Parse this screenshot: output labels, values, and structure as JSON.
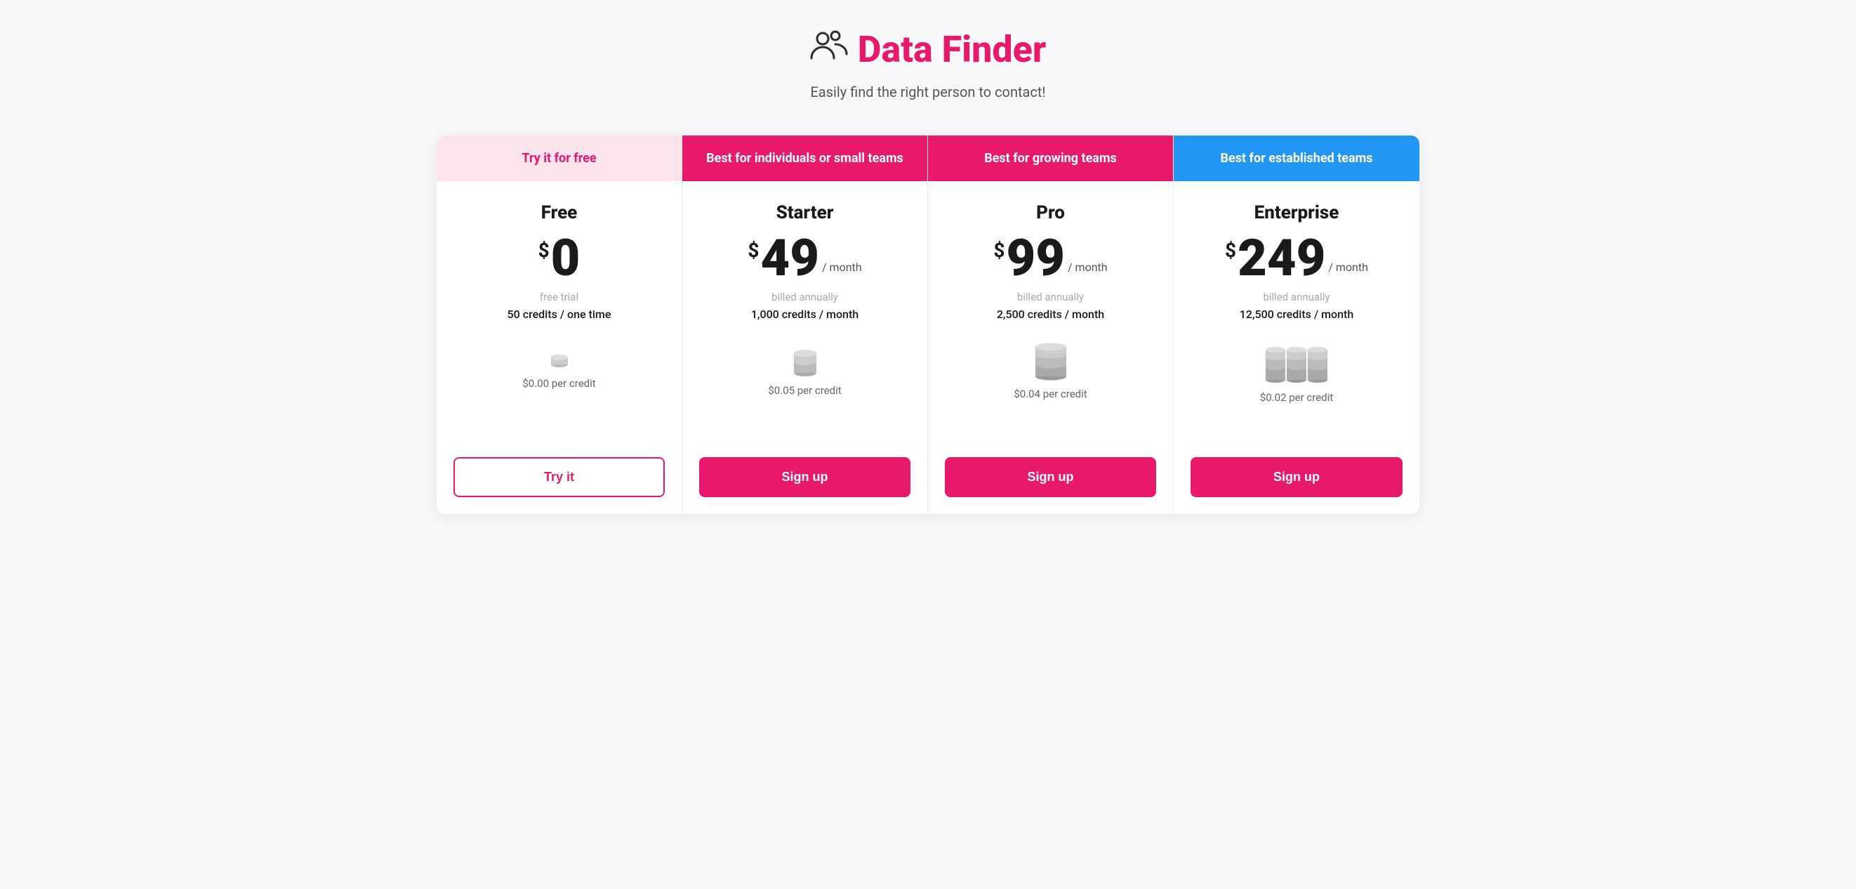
{
  "header": {
    "title": "Data Finder",
    "subtitle": "Easily find the right person to contact!",
    "logo_icon": "👥"
  },
  "plans": [
    {
      "id": "free",
      "badge": "Try it for free",
      "badge_style": "free",
      "name": "Free",
      "price": "0",
      "period": "",
      "billing": "free trial",
      "credits": "50 credits / one time",
      "per_credit": "$0.00 per credit",
      "cta_label": "Try it",
      "cta_style": "btn-free",
      "coin_size": "small"
    },
    {
      "id": "starter",
      "badge": "Best for individuals or small teams",
      "badge_style": "starter",
      "name": "Starter",
      "price": "49",
      "period": "/ month",
      "billing": "billed annually",
      "credits": "1,000 credits / month",
      "per_credit": "$0.05 per credit",
      "cta_label": "Sign up",
      "cta_style": "btn-pink",
      "coin_size": "medium"
    },
    {
      "id": "pro",
      "badge": "Best for growing teams",
      "badge_style": "pro",
      "name": "Pro",
      "price": "99",
      "period": "/ month",
      "billing": "billed annually",
      "credits": "2,500 credits / month",
      "per_credit": "$0.04 per credit",
      "cta_label": "Sign up",
      "cta_style": "btn-pink",
      "coin_size": "large"
    },
    {
      "id": "enterprise",
      "badge": "Best for established teams",
      "badge_style": "enterprise",
      "name": "Enterprise",
      "price": "249",
      "period": "/ month",
      "billing": "billed annually",
      "credits": "12,500 credits / month",
      "per_credit": "$0.02 per credit",
      "cta_label": "Sign up",
      "cta_style": "btn-pink",
      "coin_size": "xlarge"
    }
  ]
}
